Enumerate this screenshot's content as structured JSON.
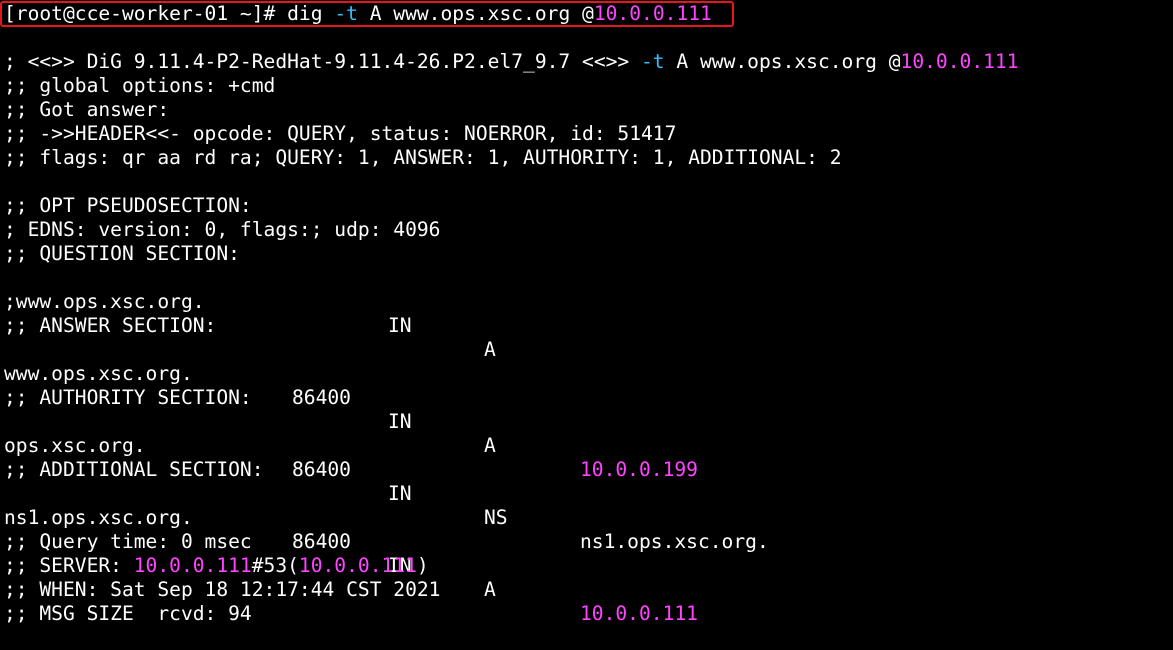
{
  "colors": {
    "background": "#000000",
    "text": "#ffffff",
    "ip_highlight": "#ff44ff",
    "flag_highlight": "#33bbff",
    "box_outline": "#e8161c"
  },
  "command": {
    "prompt": "[root@cce-worker-01 ~]# ",
    "cmd": "dig ",
    "flag": "-t",
    "args": " A www.ops.xsc.org @",
    "server_ip": "10.0.0.111"
  },
  "banner": {
    "prefix": "; <<>> DiG 9.11.4-P2-RedHat-9.11.4-26.P2.el7_9.7 <<>> ",
    "flag": "-t",
    "args": " A www.ops.xsc.org @",
    "server_ip": "10.0.0.111"
  },
  "header_lines": [
    ";; global options: +cmd",
    ";; Got answer:",
    ";; ->>HEADER<<- opcode: QUERY, status: NOERROR, id: 51417",
    ";; flags: qr aa rd ra; QUERY: 1, ANSWER: 1, AUTHORITY: 1, ADDITIONAL: 2"
  ],
  "opt": {
    "title": ";; OPT PSEUDOSECTION:",
    "edns": "; EDNS: version: 0, flags:; udp: 4096"
  },
  "question": {
    "title": ";; QUESTION SECTION:",
    "name": ";www.ops.xsc.org.",
    "class": "IN",
    "type": "A"
  },
  "answer": {
    "title": ";; ANSWER SECTION:",
    "name": "www.ops.xsc.org.",
    "ttl": "86400",
    "class": "IN",
    "type": "A",
    "value": "10.0.0.199"
  },
  "authority": {
    "title": ";; AUTHORITY SECTION:",
    "name": "ops.xsc.org.",
    "ttl": "86400",
    "class": "IN",
    "type": "NS",
    "value": "ns1.ops.xsc.org."
  },
  "additional": {
    "title": ";; ADDITIONAL SECTION:",
    "name": "ns1.ops.xsc.org.",
    "ttl": "86400",
    "class": "IN",
    "type": "A",
    "value": "10.0.0.111"
  },
  "stats": {
    "query_time": ";; Query time: 0 msec",
    "server_prefix": ";; SERVER: ",
    "server_ip": "10.0.0.111",
    "server_port": "#53(",
    "server_ip2": "10.0.0.111",
    "server_close": ")",
    "when": ";; WHEN: Sat Sep 18 12:17:44 CST 2021",
    "msg_size": ";; MSG SIZE  rcvd: 94"
  }
}
